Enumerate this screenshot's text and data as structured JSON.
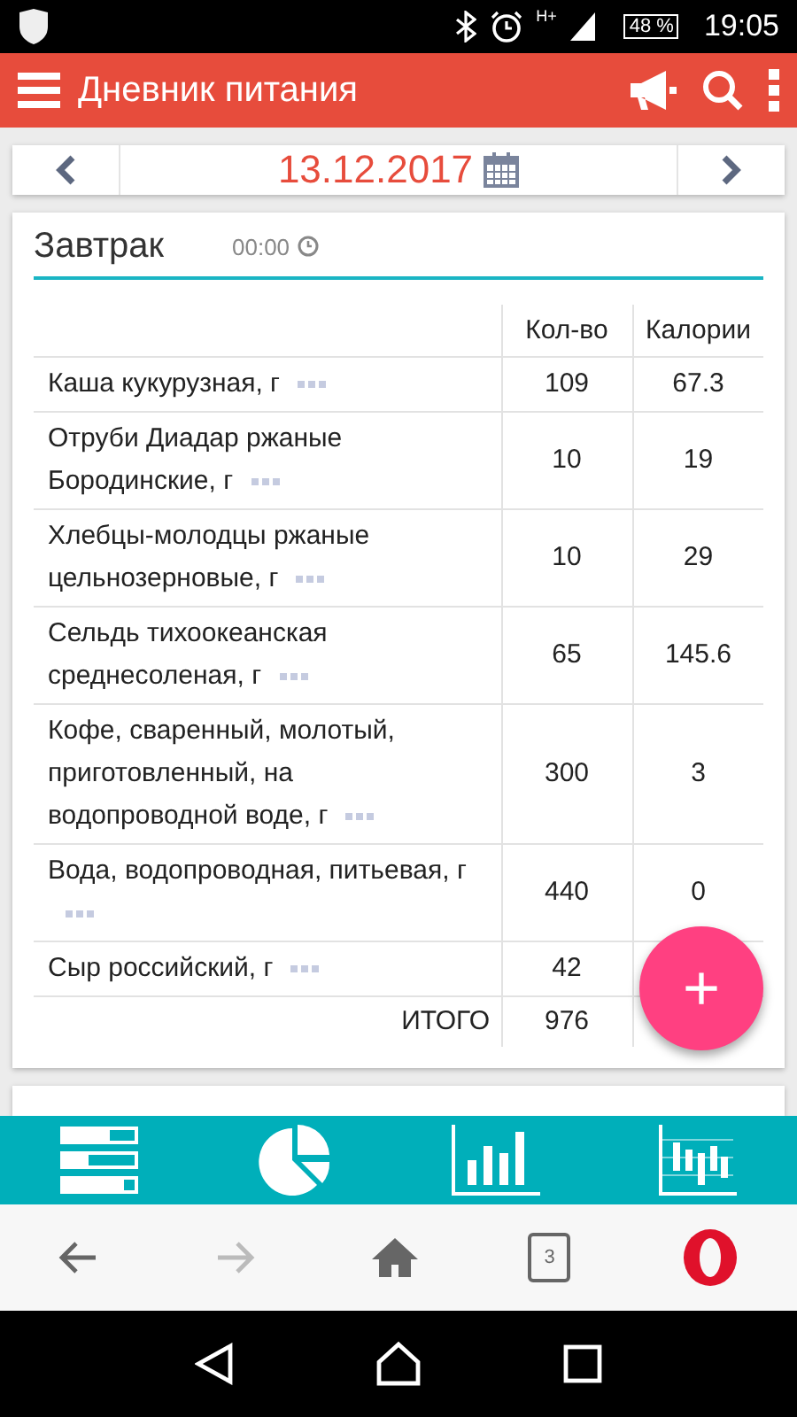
{
  "status_bar": {
    "network": "H+",
    "battery": "48 %",
    "time": "19:05"
  },
  "app_bar": {
    "title": "Дневник питания"
  },
  "date_nav": {
    "date": "13.12.2017"
  },
  "meal": {
    "title": "Завтрак",
    "time": "00:00",
    "columns": [
      "Кол-во",
      "Калории"
    ],
    "rows": [
      {
        "name": "Каша кукурузная, г",
        "qty": "109",
        "calories": "67.3"
      },
      {
        "name": "Отруби Диадар ржаные Бородинские, г",
        "qty": "10",
        "calories": "19"
      },
      {
        "name": "Хлебцы-молодцы ржаные цельнозерновые, г",
        "qty": "10",
        "calories": "29"
      },
      {
        "name": "Сельдь тихоокеанская среднесоленая, г",
        "qty": "65",
        "calories": "145.6"
      },
      {
        "name": "Кофе, сваренный, молотый, приготовленный, на водопроводной воде, г",
        "qty": "300",
        "calories": "3"
      },
      {
        "name": "Вода, водопроводная, питьевая, г",
        "qty": "440",
        "calories": "0"
      },
      {
        "name": "Сыр российский, г",
        "qty": "42"
      }
    ],
    "total": {
      "label": "ИТОГО",
      "qty": "976"
    }
  },
  "fab": {
    "label": "+"
  },
  "bottom_tabs": [
    {
      "kind": "list"
    },
    {
      "kind": "pie"
    },
    {
      "kind": "bars"
    },
    {
      "kind": "candles"
    }
  ],
  "browser_bar": [
    {
      "kind": "back",
      "disabled": false
    },
    {
      "kind": "forward",
      "disabled": true
    },
    {
      "kind": "home",
      "disabled": false
    },
    {
      "kind": "tabs",
      "count": "3",
      "disabled": false
    },
    {
      "kind": "menu",
      "disabled": false
    }
  ]
}
